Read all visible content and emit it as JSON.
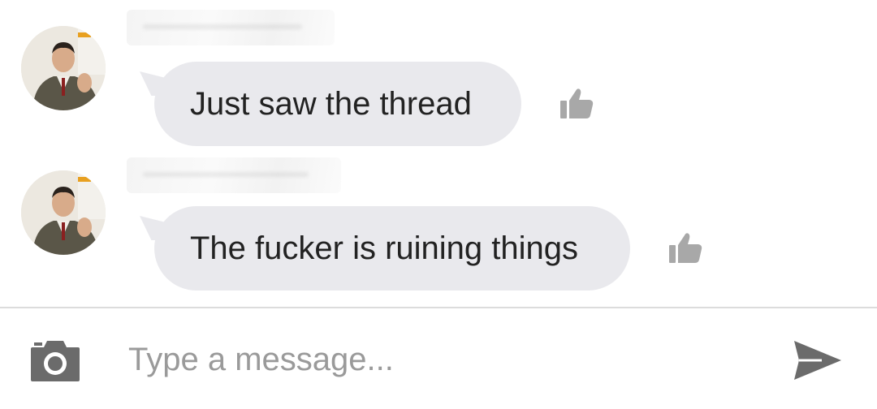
{
  "messages": [
    {
      "sender": "",
      "text": "Just saw the thread",
      "like_icon": "thumbs-up-icon"
    },
    {
      "sender": "",
      "text": "The fucker is ruining things",
      "like_icon": "thumbs-up-icon"
    }
  ],
  "composer": {
    "placeholder": "Type a message...",
    "value": "",
    "camera_icon": "camera-icon",
    "send_icon": "send-icon"
  },
  "colors": {
    "bubble": "#e9e9ed",
    "text": "#222222",
    "icon_gray": "#a8a8a8",
    "composer_icon": "#6b6b6b",
    "placeholder": "#9a9a9a"
  }
}
